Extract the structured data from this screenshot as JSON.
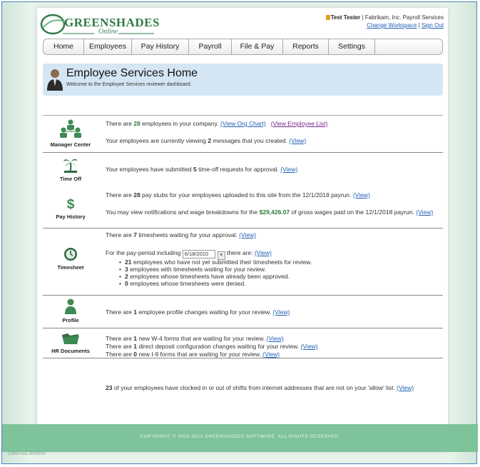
{
  "brand": {
    "name": "GREENSHADES",
    "tagline": "Online"
  },
  "user": {
    "name": "Test Tester",
    "org": " | Fabrikam, Inc. Payroll Services",
    "change_workspace": "Change Workspace",
    "separator": " | ",
    "sign_out": "Sign Out"
  },
  "nav": [
    {
      "label": "Home"
    },
    {
      "label": "Employees"
    },
    {
      "label": "Pay History"
    },
    {
      "label": "Payroll"
    },
    {
      "label": "File & Pay"
    },
    {
      "label": "Reports"
    },
    {
      "label": "Settings"
    },
    {
      "label": ""
    }
  ],
  "banner": {
    "title": "Employee Services Home",
    "subtitle": "Welcome to the Employee Services reviewer dashboard."
  },
  "sections": {
    "manager": {
      "label": "Manager Center",
      "l1_pre": "There are ",
      "l1_num": "28",
      "l1_post": " employees in your company.  ",
      "l1_link1": "(View Org Chart)",
      "l1_link2": "(View Employee List)",
      "l2_pre": "Your employees are currently viewing ",
      "l2_num": "2",
      "l2_post": " messages that you created. ",
      "l2_link": "(View)"
    },
    "timeoff": {
      "label": "Time Off",
      "l1_pre": "Your employees have submitted ",
      "l1_num": "5",
      "l1_post": " time-off requests for approval. ",
      "l1_link": "(View)"
    },
    "payhistory": {
      "label": "Pay History",
      "l1_pre": "There are ",
      "l1_num": "28",
      "l1_post": " pay stubs for your employees uploaded to this site from the 12/1/2018 payrun. ",
      "l1_link": "(View)",
      "l2_pre": "You may view notifications and wage breakdowns for the ",
      "l2_amount": "$29,426.07",
      "l2_post": " of gross wages paid on the 12/1/2018 payrun.",
      "l2_link": "(View)"
    },
    "timesheet": {
      "label": "Timesheet",
      "l1_pre": "There are ",
      "l1_num": "7",
      "l1_post": " timesheets waiting for your approval. ",
      "l1_link": "(View)",
      "l2_pre": "For the pay-period including ",
      "l2_date": "6/18/2010",
      "l2_post": " there are:  ",
      "l2_link": "(View)",
      "bullets": [
        {
          "num": "21",
          "text": " employees who have not yet submitted their timesheets for review."
        },
        {
          "num": "3",
          "text": " employees with timesheets waiting for your review."
        },
        {
          "num": "2",
          "text": " employees whose timesheets have already been approved."
        },
        {
          "num": "0",
          "text": " employees whose timesheets were denied."
        }
      ]
    },
    "profile": {
      "label": "Profile",
      "l1_pre": "There are ",
      "l1_num": "1",
      "l1_post": " employee profile changes waiting for your review. ",
      "l1_link": "(View)"
    },
    "hrdocs": {
      "label": "HR Documents",
      "l1_pre": "There are ",
      "l1_num": "1",
      "l1_post": " new W-4 forms that are waiting for your review. ",
      "l1_link": "(View)",
      "l2_pre": "There are ",
      "l2_num": "1",
      "l2_post": " direct deposit configuration changes waiting for your review. ",
      "l2_link": "(View)",
      "l3_pre": "There are ",
      "l3_num": "0",
      "l3_post": " new I-9 forms that are waiting for your review. ",
      "l3_link": "(View)"
    },
    "clock": {
      "num": "23",
      "text": " of your employees have clocked in or out of shifts from internet addresses that are not on your 'allow' list. ",
      "link": "(View)"
    }
  },
  "footer": {
    "copyright": "Copyright © 2003-2013 Greenshades Software. All Rights Reserved."
  },
  "build": "D3W3-GD-3000010",
  "colors": {
    "accent_green": "#2f7a48",
    "link": "#1f5fb5",
    "banner_bg": "#d4e6f4",
    "footer_bg": "#7ec39a"
  }
}
